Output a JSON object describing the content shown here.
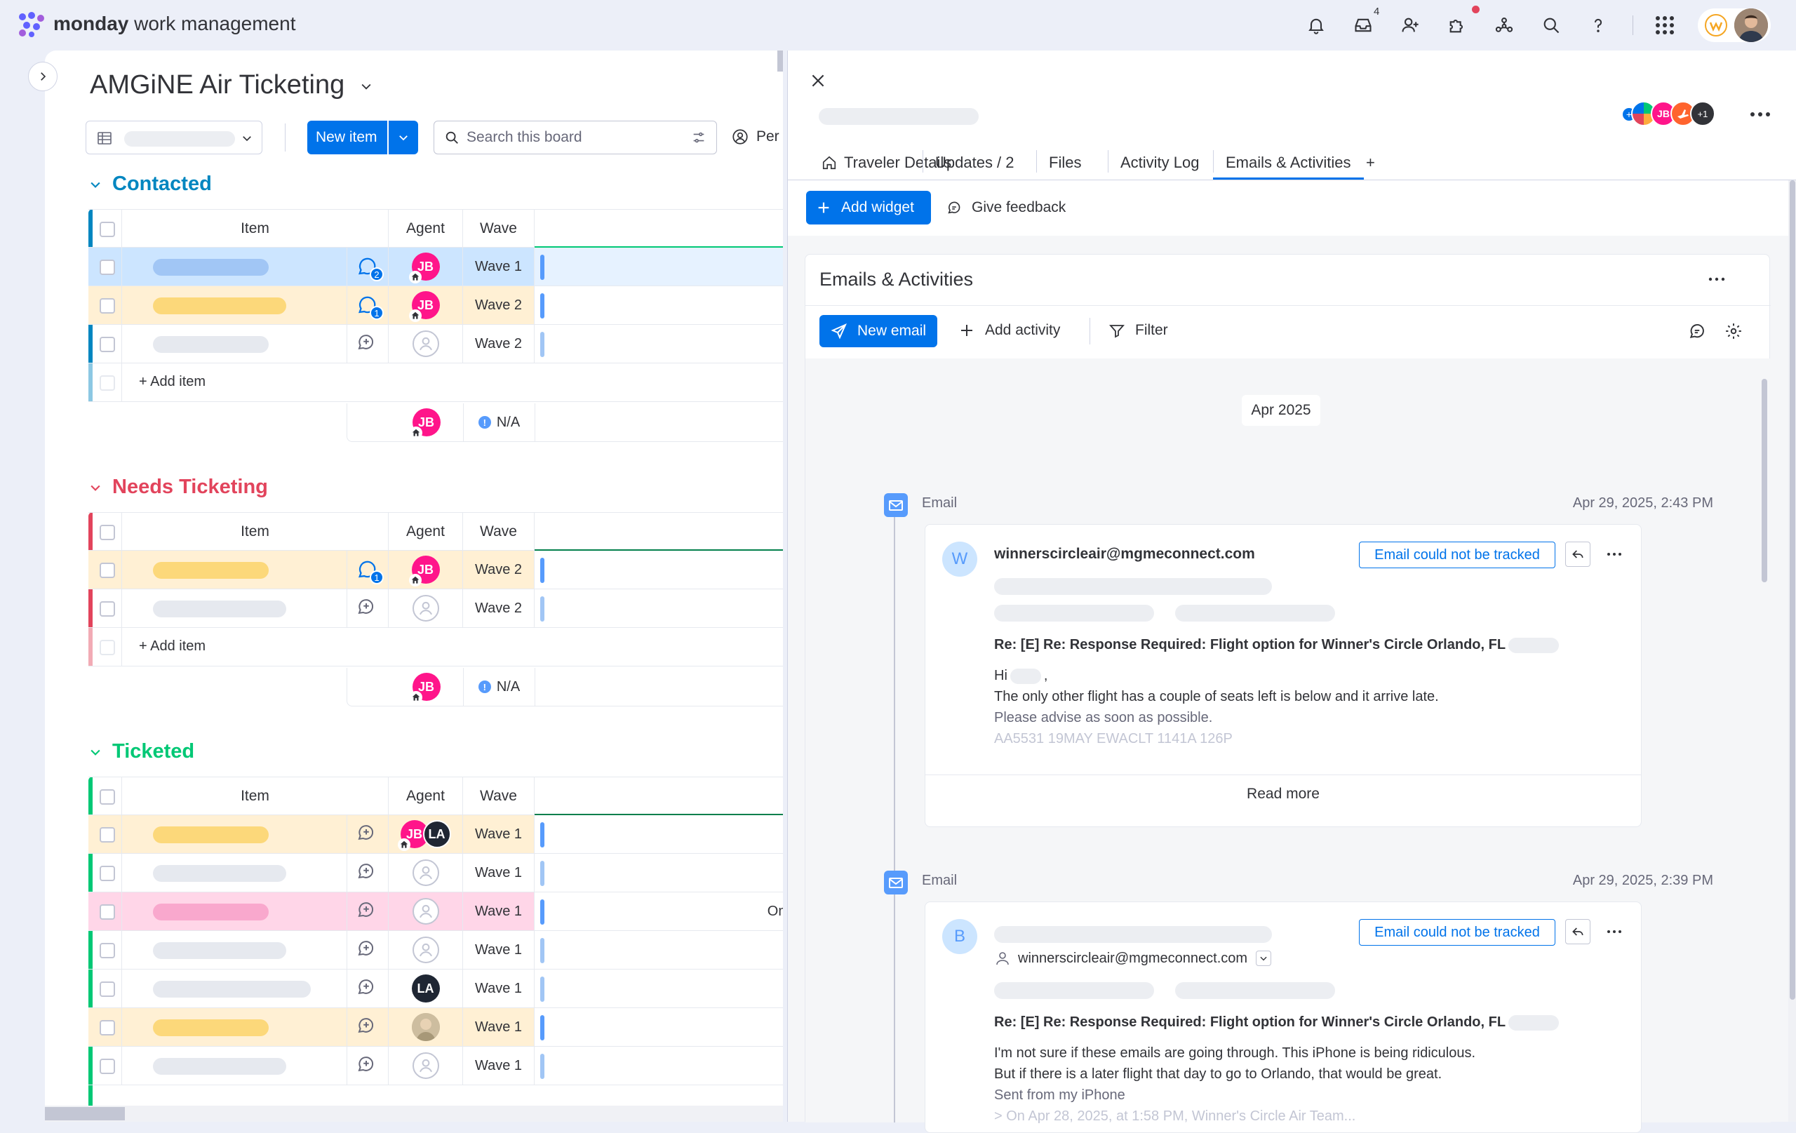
{
  "app": {
    "brand_bold": "monday",
    "brand_rest": " work management",
    "inbox_count": "4"
  },
  "board": {
    "title": "AMGiNE Air Ticketing",
    "new_item_label": "New item",
    "search_placeholder": "Search this board",
    "person_label": "Per",
    "add_item_label": "+ Add item",
    "na_label": "N/A",
    "col_item": "Item",
    "col_agent": "Agent",
    "col_wave": "Wave",
    "groups": [
      {
        "title": "Contacted",
        "color": "#037f4c",
        "accent": "#0086c0",
        "rows": [
          {
            "wave": "Wave 1",
            "agent": "JB",
            "highlight": "#cce5ff",
            "pill": "#a1c6f5",
            "updates": "2"
          },
          {
            "wave": "Wave 2",
            "agent": "JB",
            "highlight": "#fff0d4",
            "pill": "#fcd87a",
            "updates": "1"
          },
          {
            "wave": "Wave 2",
            "agent": "",
            "highlight": "",
            "pill": "#e6e9ef",
            "updates": ""
          }
        ]
      },
      {
        "title": "Needs Ticketing",
        "accent": "#e2445c",
        "rows": [
          {
            "wave": "Wave 2",
            "agent": "JB",
            "highlight": "#fff0d4",
            "pill": "#fcd87a",
            "updates": "1"
          },
          {
            "wave": "Wave 2",
            "agent": "",
            "highlight": "",
            "pill": "#e6e9ef",
            "updates": ""
          }
        ]
      },
      {
        "title": "Ticketed",
        "accent": "#00c875",
        "rows": [
          {
            "wave": "Wave 1",
            "agent": "JB LA",
            "highlight": "#fff0d4",
            "pill": "#fcd87a"
          },
          {
            "wave": "Wave 1",
            "agent": "",
            "highlight": "",
            "pill": "#e6e9ef"
          },
          {
            "wave": "Wave 1",
            "agent": "",
            "highlight": "#ffd6e8",
            "pill": "#f9a8cd",
            "extra": "Om"
          },
          {
            "wave": "Wave 1",
            "agent": "",
            "highlight": "",
            "pill": "#e6e9ef"
          },
          {
            "wave": "Wave 1",
            "agent": "LA",
            "highlight": "",
            "pill": "#e6e9ef"
          },
          {
            "wave": "Wave 1",
            "agent": "photo",
            "highlight": "#fff0d4",
            "pill": "#fcd87a"
          },
          {
            "wave": "Wave 1",
            "agent": "",
            "highlight": "",
            "pill": "#e6e9ef"
          }
        ]
      }
    ]
  },
  "panel": {
    "avatar_more": "+1",
    "tabs": [
      "Traveler Details",
      "Updates / 2",
      "Files",
      "Activity Log",
      "Emails & Activities",
      "+"
    ],
    "add_widget_label": "Add widget",
    "feedback_label": "Give feedback",
    "widget_title": "Emails & Activities",
    "new_email_label": "New email",
    "add_activity_label": "Add activity",
    "filter_label": "Filter",
    "date_chip": "Apr 2025",
    "emails": [
      {
        "type_label": "Email",
        "timestamp": "Apr 29, 2025, 2:43 PM",
        "avatar": "W",
        "from": "winnerscircleair@mgmeconnect.com",
        "tracked_label": "Email could not be tracked",
        "subject": "Re: [E] Re: Response Required: Flight option for Winner's Circle Orlando, FL",
        "greeting": "Hi",
        "line1": "The only other flight has a couple of seats left is below and it arrive late.",
        "line2": "Please advise as soon as possible.",
        "line3": "AA5531 19MAY  EWACLT  1141A  126P",
        "read_more": "Read more"
      },
      {
        "type_label": "Email",
        "timestamp": "Apr 29, 2025, 2:39 PM",
        "avatar": "B",
        "to": "winnerscircleair@mgmeconnect.com",
        "tracked_label": "Email could not be tracked",
        "subject": "Re: [E] Re: Response Required: Flight option for Winner's Circle Orlando, FL",
        "line1": "I'm not sure if these emails are going through. This iPhone is being ridiculous.",
        "line2": "But if there is a later flight that day to go to Orlando, that would be great.",
        "line3": "Sent from my iPhone",
        "line4": "> On Apr 28, 2025, at 1:58 PM, Winner's Circle Air Team..."
      }
    ]
  }
}
